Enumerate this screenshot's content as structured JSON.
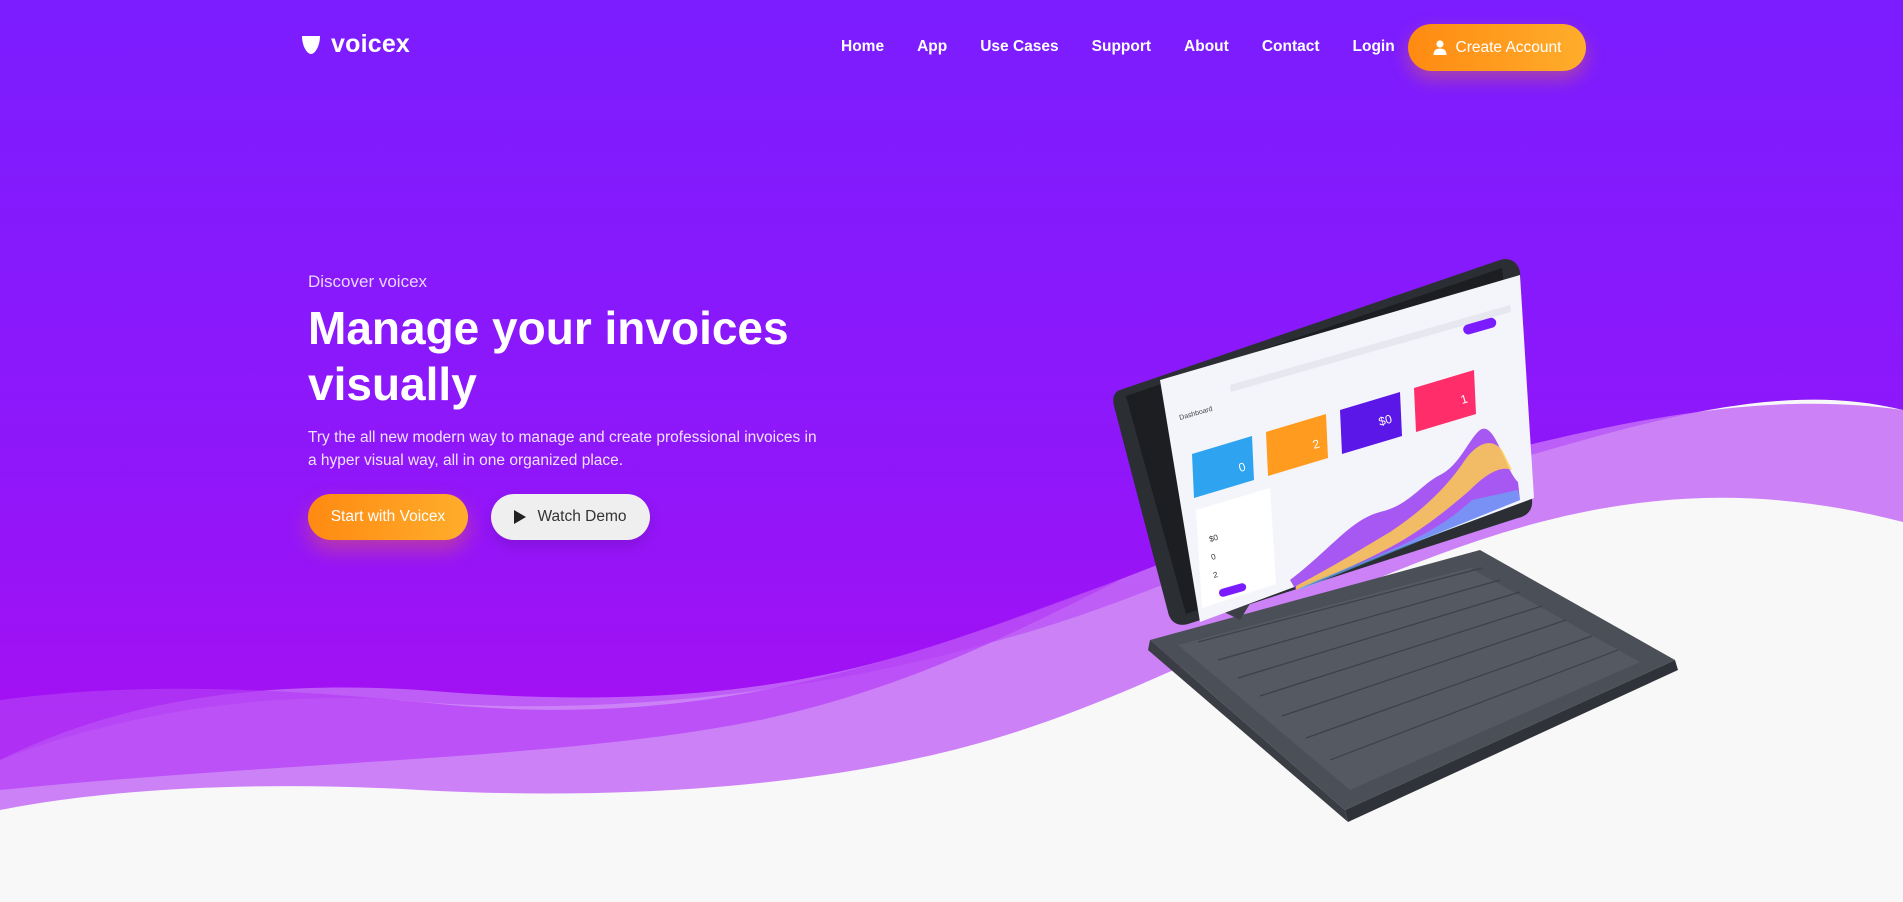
{
  "brand": {
    "name": "voicex"
  },
  "nav": {
    "items": [
      "Home",
      "App",
      "Use Cases",
      "Support",
      "About",
      "Contact",
      "Login"
    ],
    "cta_label": "Create Account"
  },
  "hero": {
    "eyebrow": "Discover voicex",
    "headline_line1": "Manage your invoices",
    "headline_line2": "visually",
    "subtext": "Try the all new modern way to manage and create professional invoices in a hyper visual way, all in one organized place.",
    "primary_cta": "Start with Voicex",
    "secondary_cta": "Watch Demo"
  },
  "device_screen": {
    "title": "Dashboard",
    "cards": [
      {
        "value": "0",
        "color": "#2ea4f0"
      },
      {
        "value": "2",
        "color": "#ff9b1f"
      },
      {
        "value": "$0",
        "color": "#5a17e8"
      },
      {
        "value": "1",
        "color": "#ff2d6a"
      }
    ],
    "stats": [
      "$0",
      "0",
      "2"
    ]
  },
  "colors": {
    "bg_top": "#7a1cff",
    "bg_bottom": "#a011f5",
    "wave_light": "#c46cf7",
    "accent_orange": "#ff9a1f"
  },
  "icons": [
    "logo-mark-icon",
    "user-icon",
    "play-icon"
  ]
}
